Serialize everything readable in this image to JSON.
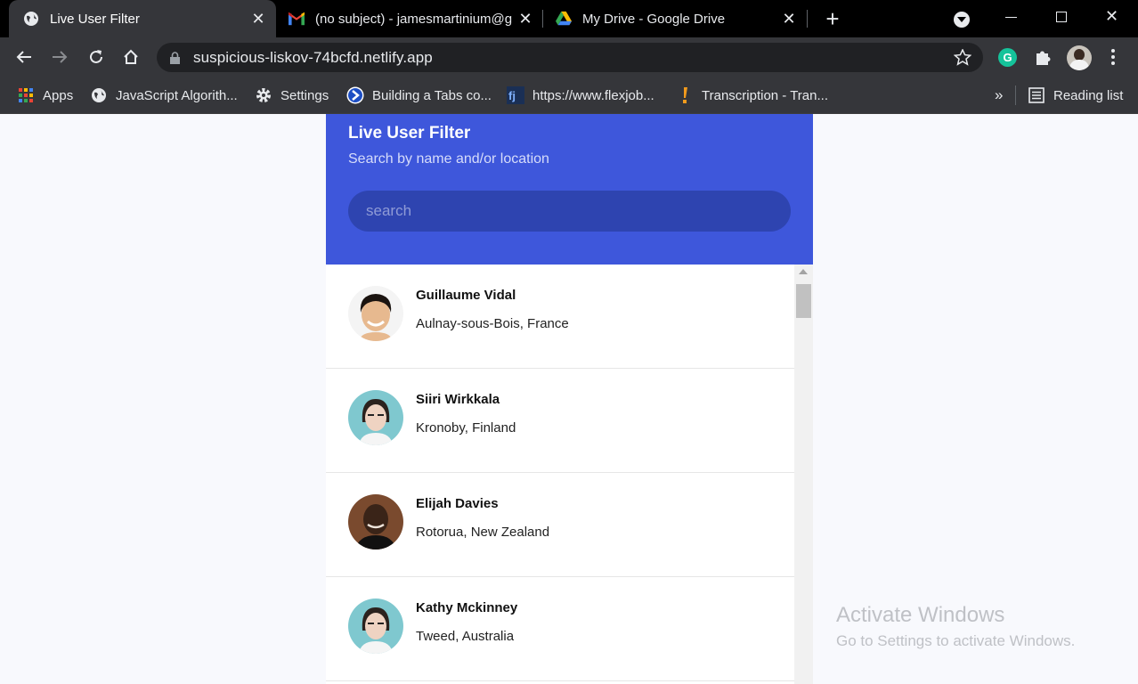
{
  "browser": {
    "tabs": [
      {
        "title": "Live User Filter",
        "icon": "globe-icon",
        "active": true
      },
      {
        "title": "(no subject) - jamesmartinium@g",
        "icon": "gmail-icon",
        "active": false
      },
      {
        "title": "My Drive - Google Drive",
        "icon": "drive-icon",
        "active": false
      }
    ],
    "url": "suspicious-liskov-74bcfd.netlify.app",
    "bookmarks": [
      {
        "label": "Apps",
        "icon": "apps-grid-icon"
      },
      {
        "label": "JavaScript Algorith...",
        "icon": "globe-icon"
      },
      {
        "label": "Settings",
        "icon": "gear-icon"
      },
      {
        "label": "Building a Tabs co...",
        "icon": "chevron-badge-icon"
      },
      {
        "label": "https://www.flexjob...",
        "icon": "flexjobs-icon"
      },
      {
        "label": "Transcription - Tran...",
        "icon": "exclamation-icon"
      }
    ],
    "overflow_label": "»",
    "reading_list": "Reading list"
  },
  "app": {
    "title": "Live User Filter",
    "subtitle": "Search by name and/or location",
    "search_placeholder": "search",
    "accent_color": "#3e57db",
    "users": [
      {
        "name": "Guillaume Vidal",
        "location": "Aulnay-sous-Bois, France"
      },
      {
        "name": "Siiri Wirkkala",
        "location": "Kronoby, Finland"
      },
      {
        "name": "Elijah Davies",
        "location": "Rotorua, New Zealand"
      },
      {
        "name": "Kathy Mckinney",
        "location": "Tweed, Australia"
      }
    ]
  },
  "watermark": {
    "line1": "Activate Windows",
    "line2": "Go to Settings to activate Windows."
  }
}
